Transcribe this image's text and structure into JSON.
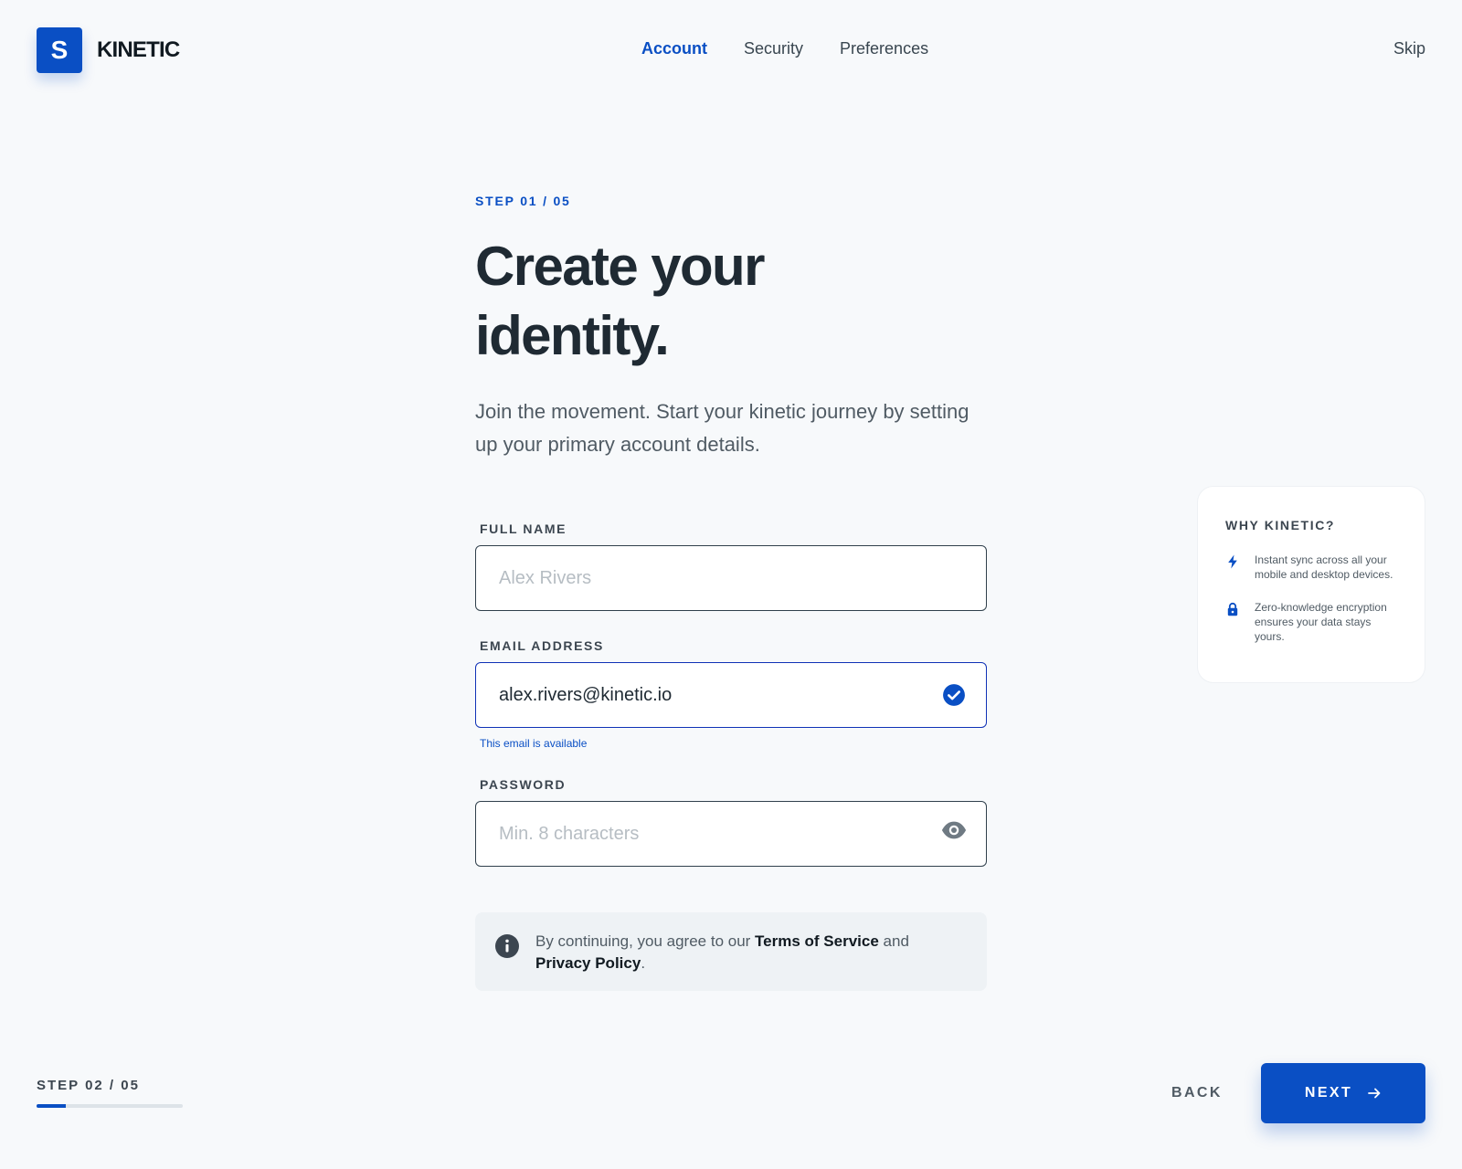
{
  "brand": {
    "logo_letter": "S",
    "name": "KINETIC"
  },
  "nav": {
    "tabs": [
      {
        "label": "Account",
        "active": true
      },
      {
        "label": "Security",
        "active": false
      },
      {
        "label": "Preferences",
        "active": false
      }
    ],
    "skip_label": "Skip"
  },
  "main": {
    "step_label": "STEP 01 / 05",
    "headline": "Create your identity.",
    "subtitle": "Join the movement. Start your kinetic journey by setting up your primary account details."
  },
  "form": {
    "full_name": {
      "label": "FULL NAME",
      "value": "",
      "placeholder": "Alex Rivers"
    },
    "email": {
      "label": "EMAIL ADDRESS",
      "value": "alex.rivers@kinetic.io",
      "placeholder": "",
      "status_icon": "check-circle-icon",
      "hint": "This email is available"
    },
    "password": {
      "label": "PASSWORD",
      "value": "",
      "placeholder": "Min. 8 characters",
      "toggle_icon": "eye-icon"
    }
  },
  "consent": {
    "icon": "info-icon",
    "prefix": "By continuing, you agree to our ",
    "terms_label": "Terms of Service",
    "conjunction": " and ",
    "privacy_label": "Privacy Policy",
    "suffix": "."
  },
  "sidebar_card": {
    "title": "WHY KINETIC?",
    "items": [
      {
        "icon": "lightning-icon",
        "text": "Instant sync across all your mobile and desktop devices."
      },
      {
        "icon": "lock-icon",
        "text": "Zero-knowledge encryption ensures your data stays yours."
      }
    ]
  },
  "footer": {
    "progress_label": "STEP 02 / 05",
    "progress_fraction": 0.2,
    "back_label": "BACK",
    "next_label": "NEXT",
    "next_icon": "arrow-right-icon"
  },
  "colors": {
    "accent": "#0a4fc4",
    "background": "#f7f9fb",
    "text_primary": "#1f2a33",
    "text_secondary": "#505b64",
    "input_border": "#30404c",
    "focus_border": "#1032b6"
  }
}
